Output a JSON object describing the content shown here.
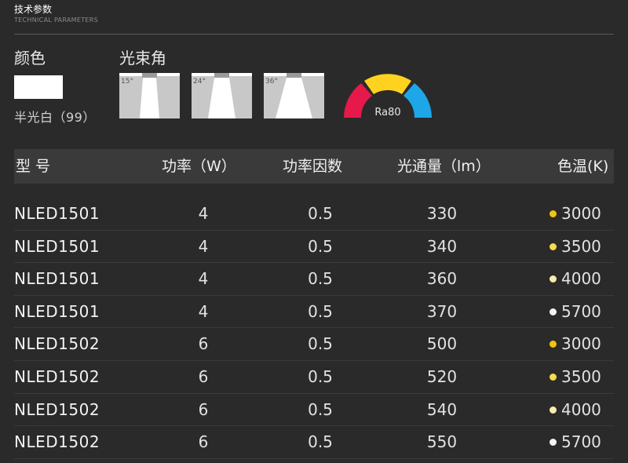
{
  "header": {
    "title": "技术参数",
    "subtitle": "TECHNICAL PARAMETERS"
  },
  "color": {
    "label": "颜色",
    "name": "半光白（99）",
    "swatch": "#ffffff"
  },
  "beam": {
    "label": "光束角",
    "angles": [
      "15°",
      "24°",
      "36°"
    ]
  },
  "cri": {
    "label": "Ra80",
    "colors": [
      "#e6194b",
      "#ffd21f",
      "#1ea7e8"
    ]
  },
  "table": {
    "headers": [
      "型  号",
      "功率（W）",
      "功率因数",
      "光通量（lm）",
      "色温(K)"
    ],
    "rows": [
      {
        "model": "NLED1501",
        "power": "4",
        "pf": "0.5",
        "lumen": "330",
        "cct": "3000",
        "dot": "#f1c40f"
      },
      {
        "model": "NLED1501",
        "power": "4",
        "pf": "0.5",
        "lumen": "340",
        "cct": "3500",
        "dot": "#f5dc4a"
      },
      {
        "model": "NLED1501",
        "power": "4",
        "pf": "0.5",
        "lumen": "360",
        "cct": "4000",
        "dot": "#f7ecae"
      },
      {
        "model": "NLED1501",
        "power": "4",
        "pf": "0.5",
        "lumen": "370",
        "cct": "5700",
        "dot": "#f4f4f4"
      },
      {
        "model": "NLED1502",
        "power": "6",
        "pf": "0.5",
        "lumen": "500",
        "cct": "3000",
        "dot": "#f1c40f"
      },
      {
        "model": "NLED1502",
        "power": "6",
        "pf": "0.5",
        "lumen": "520",
        "cct": "3500",
        "dot": "#f5dc4a"
      },
      {
        "model": "NLED1502",
        "power": "6",
        "pf": "0.5",
        "lumen": "540",
        "cct": "4000",
        "dot": "#f7ecae"
      },
      {
        "model": "NLED1502",
        "power": "6",
        "pf": "0.5",
        "lumen": "550",
        "cct": "5700",
        "dot": "#f4f4f4"
      }
    ]
  }
}
